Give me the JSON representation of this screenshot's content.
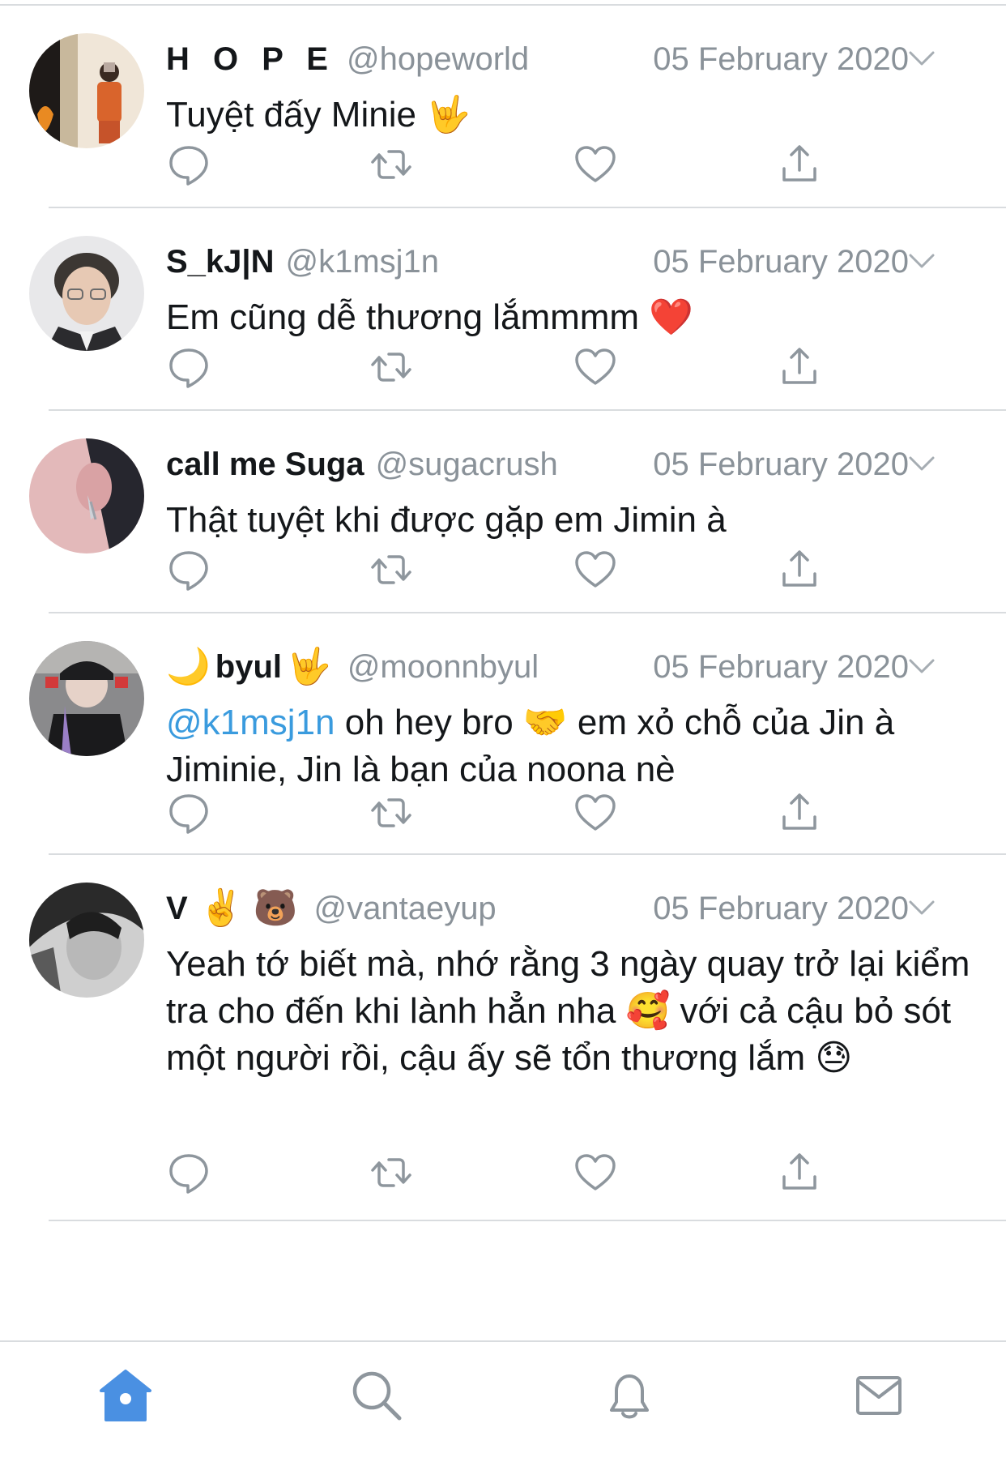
{
  "colors": {
    "accent": "#4a90e2",
    "mention": "#3a9bde",
    "secondary_text": "#8a9299",
    "primary_text": "#14171a",
    "divider": "#d9dcdf"
  },
  "tweets": [
    {
      "display_name": "H O P E",
      "name_emojis_before": "",
      "name_emojis_after": "",
      "handle": "@hopeworld",
      "date": "05 February 2020",
      "mention": "",
      "text": "Tuyệt đấy Minie 🤟"
    },
    {
      "display_name": "S_kJ|N",
      "name_emojis_before": "",
      "name_emojis_after": "",
      "handle": "@k1msj1n",
      "date": "05 February 2020",
      "mention": "",
      "text": "Em cũng dễ thương lắmmmm ❤️"
    },
    {
      "display_name": "call me Suga",
      "name_emojis_before": "",
      "name_emojis_after": "",
      "handle": "@sugacrush",
      "date": "05 February 2020",
      "mention": "",
      "text": "Thật tuyệt khi được gặp em Jimin à"
    },
    {
      "display_name": "byul",
      "name_emojis_before": "🌙",
      "name_emojis_after": "🤟",
      "handle": "@moonnbyul",
      "date": "05 February 2020",
      "mention": "@k1msj1n",
      "text": " oh hey bro 🤝 em xỏ chỗ của Jin à Jiminie, Jin là bạn của noona nè"
    },
    {
      "display_name": "V",
      "name_emojis_before": "",
      "name_emojis_after": "✌️ 🐻",
      "handle": "@vantaeyup",
      "date": "05 February 2020",
      "mention": "",
      "text": "Yeah tớ biết mà, nhớ rằng 3 ngày quay trở lại kiểm tra cho đến khi lành hẳn nha 🥰 với cả cậu bỏ sót một người rồi, cậu ấy sẽ tổn thương lắm 😓"
    }
  ],
  "tabbar": {
    "items": [
      {
        "icon": "home-icon",
        "active": true
      },
      {
        "icon": "search-icon",
        "active": false
      },
      {
        "icon": "bell-icon",
        "active": false
      },
      {
        "icon": "mail-icon",
        "active": false
      }
    ]
  }
}
